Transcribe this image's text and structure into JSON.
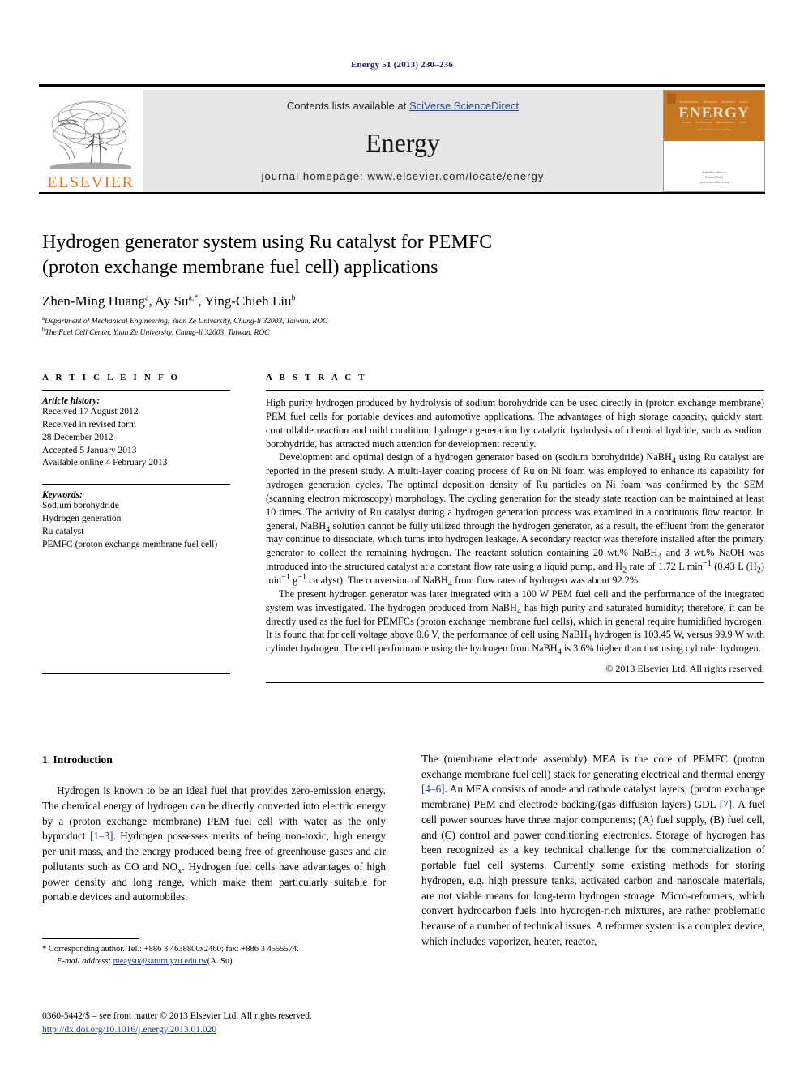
{
  "running_head": "Energy 51 (2013) 230–236",
  "banner": {
    "publisher_name": "ELSEVIER",
    "contents_prefix": "Contents lists available at ",
    "contents_link": "SciVerse ScienceDirect",
    "journal_title": "Energy",
    "homepage": "journal homepage: www.elsevier.com/locate/energy",
    "cover": {
      "title": "ENERGY",
      "subtitle": "The International Journal",
      "tiny_labels": [
        "TECHNOLOGIES",
        "RESOURCES",
        "PLANNING",
        "POLICY"
      ],
      "tiny_labels2": [
        "ENERGY",
        "CONVERSION",
        "MANAGEMENT",
        "FUELS"
      ],
      "footer_line1": "Available online at",
      "footer_line2": "ScienceDirect",
      "footer_line3": "www.sciencedirect.com"
    }
  },
  "article": {
    "title_line1": "Hydrogen generator system using Ru catalyst for PEMFC",
    "title_line2": "(proton exchange membrane fuel cell) applications",
    "authors": [
      {
        "name": "Zhen-Ming Huang",
        "marks": "a"
      },
      {
        "name": "Ay Su",
        "marks": "a,*"
      },
      {
        "name": "Ying-Chieh Liu",
        "marks": "b"
      }
    ],
    "affiliations": [
      {
        "mark": "a",
        "text": "Department of Mechanical Engineering, Yuan Ze University, Chung-li 32003, Taiwan, ROC"
      },
      {
        "mark": "b",
        "text": "The Fuel Cell Center, Yuan Ze University, Chung-li 32003, Taiwan, ROC"
      }
    ]
  },
  "article_info": {
    "heading": "A R T I C L E   I N F O",
    "history_label": "Article history:",
    "history": [
      "Received 17 August 2012",
      "Received in revised form",
      "28 December 2012",
      "Accepted 5 January 2013",
      "Available online 4 February 2013"
    ],
    "keywords_label": "Keywords:",
    "keywords": [
      "Sodium borohydride",
      "Hydrogen generation",
      "Ru catalyst",
      "PEMFC (proton exchange membrane fuel cell)"
    ]
  },
  "abstract": {
    "heading": "A B S T R A C T",
    "paragraphs": [
      "High purity hydrogen produced by hydrolysis of sodium borohydride can be used directly in (proton exchange membrane) PEM fuel cells for portable devices and automotive applications. The advantages of high storage capacity, quickly start, controllable reaction and mild condition, hydrogen generation by catalytic hydrolysis of chemical hydride, such as sodium borohydride, has attracted much attention for development recently.",
      "Development and optimal design of a hydrogen generator based on (sodium borohydride) NaBH4 using Ru catalyst are reported in the present study. A multi-layer coating process of Ru on Ni foam was employed to enhance its capability for hydrogen generation cycles. The optimal deposition density of Ru particles on Ni foam was confirmed by the SEM (scanning electron microscopy) morphology. The cycling generation for the steady state reaction can be maintained at least 10 times. The activity of Ru catalyst during a hydrogen generation process was examined in a continuous flow reactor. In general, NaBH4 solution cannot be fully utilized through the hydrogen generator, as a result, the effluent from the generator may continue to dissociate, which turns into hydrogen leakage. A secondary reactor was therefore installed after the primary generator to collect the remaining hydrogen. The reactant solution containing 20 wt.% NaBH4 and 3 wt.% NaOH was introduced into the structured catalyst at a constant flow rate using a liquid pump, and H2 rate of 1.72 L min−1 (0.43 L (H2) min−1 g−1 catalyst). The conversion of NaBH4 from flow rates of hydrogen was about 92.2%.",
      "The present hydrogen generator was later integrated with a 100 W PEM fuel cell and the performance of the integrated system was investigated. The hydrogen produced from NaBH4 has high purity and saturated humidity; therefore, it can be directly used as the fuel for PEMFCs (proton exchange membrane fuel cells), which in general require humidified hydrogen. It is found that for cell voltage above 0.6 V, the performance of cell using NaBH4 hydrogen is 103.45 W, versus 99.9 W with cylinder hydrogen. The cell performance using the hydrogen from NaBH4 is 3.6% higher than that using cylinder hydrogen."
    ],
    "copyright": "© 2013 Elsevier Ltd. All rights reserved."
  },
  "introduction": {
    "heading": "1. Introduction",
    "left_paragraph": "Hydrogen is known to be an ideal fuel that provides zero-emission energy. The chemical energy of hydrogen can be directly converted into electric energy by a (proton exchange membrane) PEM fuel cell with water as the only byproduct [1–3]. Hydrogen possesses merits of being non-toxic, high energy per unit mass, and the energy produced being free of greenhouse gases and air pollutants such as CO and NOx. Hydrogen fuel cells have advantages of high power density and long range, which make them particularly suitable for portable devices and automobiles.",
    "right_paragraph": "The (membrane electrode assembly) MEA is the core of PEMFC (proton exchange membrane fuel cell) stack for generating electrical and thermal energy [4–6]. An MEA consists of anode and cathode catalyst layers, (proton exchange membrane) PEM and electrode backing/(gas diffusion layers) GDL [7]. A fuel cell power sources have three major components; (A) fuel supply, (B) fuel cell, and (C) control and power conditioning electronics. Storage of hydrogen has been recognized as a key technical challenge for the commercialization of portable fuel cell systems. Currently some existing methods for storing hydrogen, e.g. high pressure tanks, activated carbon and nanoscale materials, are not viable means for long-term hydrogen storage. Micro-reformers, which convert hydrocarbon fuels into hydrogen-rich mixtures, are rather problematic because of a number of technical issues. A reformer system is a complex device, which includes vaporizer, heater, reactor,"
  },
  "footnotes": {
    "corresponding": "* Corresponding author. Tel.: +886 3 4638800x2460; fax: +886 3 4555574.",
    "email_label": "E-mail address:",
    "email_address": "meaysu@saturn.yzu.edu.tw",
    "email_who": "(A. Su)."
  },
  "imprint": {
    "line1": "0360-5442/$ – see front matter © 2013 Elsevier Ltd. All rights reserved.",
    "doi": "http://dx.doi.org/10.1016/j.energy.2013.01.020"
  },
  "colors": {
    "link_blue": "#1a3e8c",
    "elsevier_orange": "#E87722",
    "cover_orange": "#c8761f",
    "banner_gray": "#e6e6e6"
  }
}
